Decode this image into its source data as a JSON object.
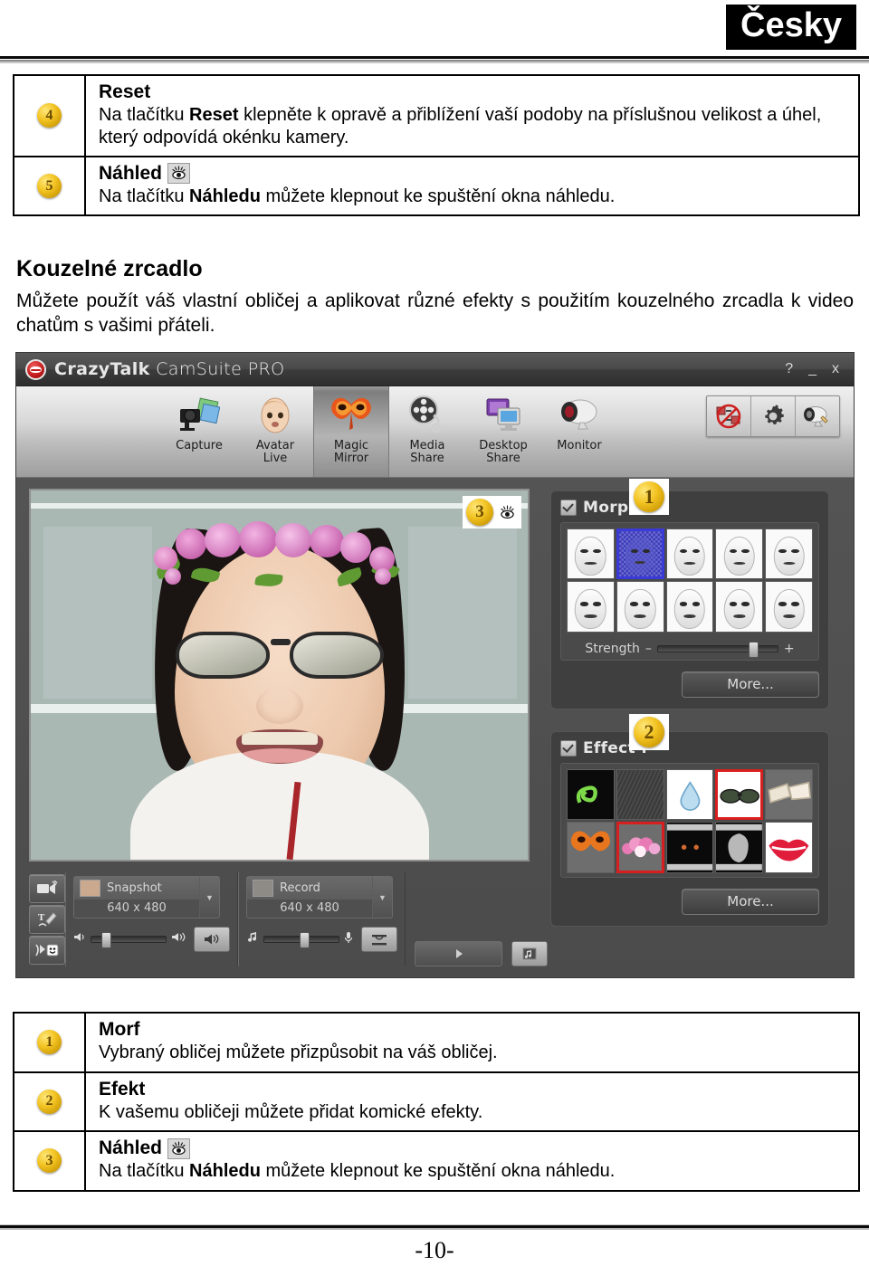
{
  "header": {
    "language_badge": "Česky"
  },
  "top_table": {
    "rows": [
      {
        "number": "4",
        "title": "Reset",
        "desc_parts": [
          "Na tlačítku ",
          "Reset",
          " klepněte k opravě a přiblížení vaší podoby na příslušnou velikost a úhel, který odpovídá okénku kamery."
        ],
        "desc_plain": "Na tlačítku Reset klepněte k opravě a přiblížení vaší podoby na příslušnou velikost a úhel, který odpovídá okénku kamery.",
        "has_eye_icon": false
      },
      {
        "number": "5",
        "title": "Náhled",
        "desc_plain": "Na tlačítku Náhledu můžete klepnout ke spuštění okna náhledu.",
        "has_eye_icon": true
      }
    ]
  },
  "section": {
    "title": "Kouzelné zrcadlo",
    "body": "Můžete použít váš vlastní obličej a aplikovat různé efekty s použitím kouzelného zrcadla k video chatům s vašimi přáteli."
  },
  "app": {
    "title_bold": "CrazyTalk",
    "title_rest": " CamSuite PRO",
    "window_buttons": [
      "?",
      "_",
      "x"
    ],
    "toolbar": [
      {
        "label_line1": "Capture",
        "label_line2": "",
        "icon": "camera-photo-icon",
        "active": false
      },
      {
        "label_line1": "Avatar",
        "label_line2": "Live",
        "icon": "avatar-face-icon",
        "active": false
      },
      {
        "label_line1": "Magic",
        "label_line2": "Mirror",
        "icon": "magic-mask-icon",
        "active": true
      },
      {
        "label_line1": "Media",
        "label_line2": "Share",
        "icon": "film-reel-icon",
        "active": false
      },
      {
        "label_line1": "Desktop",
        "label_line2": "Share",
        "icon": "monitor-share-icon",
        "active": false
      },
      {
        "label_line1": "Monitor",
        "label_line2": "",
        "icon": "webcam-monitor-icon",
        "active": false
      }
    ],
    "toolbar_right": [
      {
        "icon": "no-swap-icon"
      },
      {
        "icon": "gear-icon"
      },
      {
        "icon": "camera-settings-icon"
      }
    ],
    "video": {
      "overlay_badge": "3",
      "overlay_icon": "eye-icon"
    },
    "side_buttons": [
      {
        "icon": "video-record-icon"
      },
      {
        "icon": "text-draw-icon"
      },
      {
        "icon": "emoticon-icon"
      }
    ],
    "capture": {
      "snapshot_label": "Snapshot",
      "snapshot_res": "640 x 480",
      "record_label": "Record",
      "record_res": "640 x 480"
    },
    "morph_panel": {
      "title": "Morph :",
      "badge": "1",
      "checked": true,
      "strength_label": "Strength",
      "strength_minus": "–",
      "strength_plus": "+",
      "strength_value": 78,
      "more_label": "More...",
      "selected_index": 1,
      "thumb_count": 10
    },
    "effect_panel": {
      "title": "Effect :",
      "badge": "2",
      "checked": true,
      "more_label": "More...",
      "selected_indices": [
        3,
        6
      ],
      "thumbs": [
        {
          "name": "green-scribble-effect",
          "bg": "#0a0a0a",
          "fg": "#7ddb4a"
        },
        {
          "name": "dark-noise-effect",
          "bg": "#3c3c3c",
          "fg": "#555555"
        },
        {
          "name": "water-drop-effect",
          "bg": "#ffffff",
          "fg": "#8fc5e8"
        },
        {
          "name": "sunglasses-effect",
          "bg": "#ffffff",
          "fg": "#3b4a36"
        },
        {
          "name": "bandage-effect",
          "bg": "#6e6e6e",
          "fg": "#ece4d4"
        },
        {
          "name": "orange-mask-effect",
          "bg": "#6e6e6e",
          "fg": "#e8761f"
        },
        {
          "name": "pink-flower-crown-effect",
          "bg": "#6e6e6e",
          "fg": "#e87ab5"
        },
        {
          "name": "dark-eyes-effect",
          "bg": "#0a0a0a",
          "fg": "#c06030"
        },
        {
          "name": "ghost-effect",
          "bg": "#0a0a0a",
          "fg": "#bdbdbd"
        },
        {
          "name": "red-lips-effect",
          "bg": "#ffffff",
          "fg": "#e01e3c"
        }
      ]
    }
  },
  "bottom_table": {
    "rows": [
      {
        "number": "1",
        "title": "Morf",
        "desc_plain": "Vybraný obličej můžete přizpůsobit na váš obličej.",
        "has_eye_icon": false
      },
      {
        "number": "2",
        "title": "Efekt",
        "desc_plain": "K vašemu obličeji můžete přidat komické efekty.",
        "has_eye_icon": false
      },
      {
        "number": "3",
        "title": "Náhled",
        "desc_plain": "Na tlačítku Náhledu můžete klepnout ke spuštění okna náhledu.",
        "has_eye_icon": true
      }
    ]
  },
  "footer": {
    "page_number": "-10-"
  }
}
